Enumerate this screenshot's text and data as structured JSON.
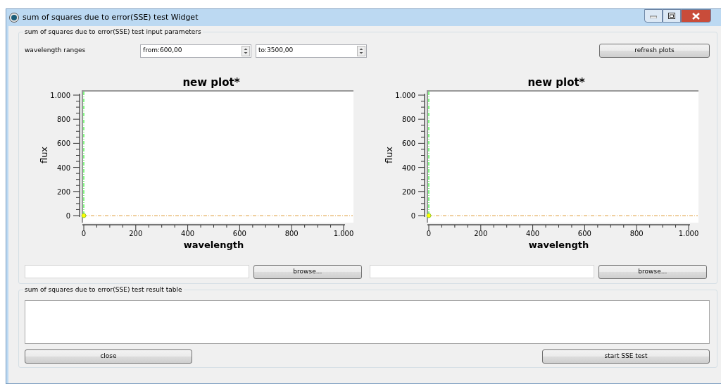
{
  "window": {
    "title": "sum of squares due to error(SSE) test Widget"
  },
  "input_group": {
    "title": "sum of squares due to error(SSE) test input parameters",
    "range_label": "wavelength ranges",
    "from_spin": {
      "value": "from:600,00"
    },
    "to_spin": {
      "value": "to:3500,00"
    },
    "refresh_button": "refresh plots"
  },
  "plots": [
    {
      "chart_data": {
        "type": "scatter",
        "title": "new plot*",
        "xlabel": "wavelength",
        "ylabel": "flux",
        "x": [
          0
        ],
        "series": [
          {
            "color": "#ffff00",
            "values": [
              0
            ]
          }
        ],
        "xlim": [
          0,
          1000
        ],
        "ylim": [
          0,
          1000
        ],
        "xticks": [
          0,
          200,
          400,
          600,
          800,
          {
            "value": 1000,
            "label": "1.000"
          }
        ],
        "yticks": [
          0,
          200,
          400,
          600,
          800,
          {
            "value": 1000,
            "label": "1.000"
          }
        ]
      },
      "browse_button": "browse..."
    },
    {
      "chart_data": {
        "type": "scatter",
        "title": "new plot*",
        "xlabel": "wavelength",
        "ylabel": "flux",
        "x": [
          0
        ],
        "series": [
          {
            "color": "#ffff00",
            "values": [
              0
            ]
          }
        ],
        "xlim": [
          0,
          1000
        ],
        "ylim": [
          0,
          1000
        ],
        "xticks": [
          0,
          200,
          400,
          600,
          800,
          {
            "value": 1000,
            "label": "1.000"
          }
        ],
        "yticks": [
          0,
          200,
          400,
          600,
          800,
          {
            "value": 1000,
            "label": "1.000"
          }
        ]
      },
      "browse_button": "browse..."
    }
  ],
  "result_group": {
    "title": "sum of squares due to error(SSE) test result table",
    "close_button": "close",
    "start_button": "start SSE test"
  }
}
